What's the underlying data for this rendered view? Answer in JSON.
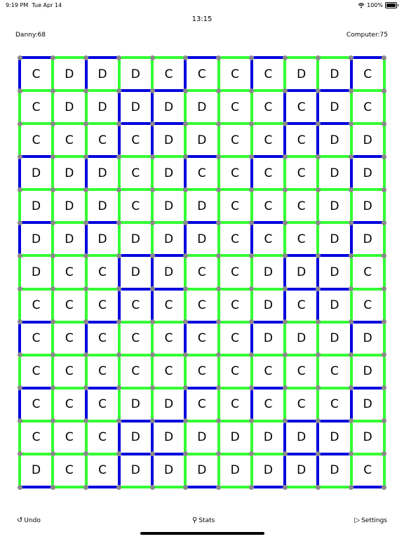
{
  "status_bar": {
    "time": "9:19 PM",
    "date": "Tue Apr 14",
    "battery_text": "100%",
    "battery_level": 1.0,
    "wifi_icon": "wifi-icon",
    "battery_icon": "battery-icon"
  },
  "game": {
    "timer": "13:15",
    "player_score_label": "Danny:68",
    "computer_score_label": "Computer:75",
    "colors": {
      "player_edge": "#33ff33",
      "computer_edge": "#0000dd",
      "dot": "#8a8a8a"
    },
    "board": {
      "rows": 13,
      "cols": 11,
      "cells": [
        [
          "C",
          "D",
          "D",
          "D",
          "C",
          "C",
          "C",
          "C",
          "D",
          "D",
          "C"
        ],
        [
          "C",
          "D",
          "D",
          "D",
          "D",
          "D",
          "C",
          "C",
          "C",
          "D",
          "C"
        ],
        [
          "C",
          "C",
          "C",
          "C",
          "D",
          "D",
          "C",
          "C",
          "C",
          "D",
          "D"
        ],
        [
          "D",
          "D",
          "D",
          "C",
          "D",
          "C",
          "C",
          "C",
          "C",
          "D",
          "D"
        ],
        [
          "D",
          "D",
          "D",
          "C",
          "D",
          "D",
          "C",
          "C",
          "C",
          "D",
          "D"
        ],
        [
          "D",
          "D",
          "D",
          "D",
          "D",
          "D",
          "C",
          "C",
          "C",
          "D",
          "D"
        ],
        [
          "D",
          "C",
          "C",
          "D",
          "D",
          "C",
          "C",
          "D",
          "D",
          "D",
          "C"
        ],
        [
          "C",
          "C",
          "C",
          "C",
          "C",
          "C",
          "C",
          "D",
          "C",
          "D",
          "C"
        ],
        [
          "C",
          "C",
          "C",
          "C",
          "C",
          "C",
          "C",
          "D",
          "D",
          "D",
          "D"
        ],
        [
          "C",
          "C",
          "C",
          "C",
          "C",
          "C",
          "C",
          "C",
          "C",
          "C",
          "D"
        ],
        [
          "C",
          "C",
          "C",
          "D",
          "D",
          "C",
          "C",
          "C",
          "C",
          "C",
          "D"
        ],
        [
          "C",
          "C",
          "C",
          "D",
          "D",
          "D",
          "D",
          "D",
          "D",
          "D",
          "D"
        ],
        [
          "D",
          "C",
          "C",
          "D",
          "D",
          "D",
          "D",
          "D",
          "D",
          "D",
          "C"
        ]
      ]
    }
  },
  "footer": {
    "undo_label": "Undo",
    "stats_label": "Stats",
    "settings_label": "Settings",
    "undo_icon": "undo-icon",
    "stats_icon": "ribbon-icon",
    "settings_icon": "forward-icon"
  }
}
